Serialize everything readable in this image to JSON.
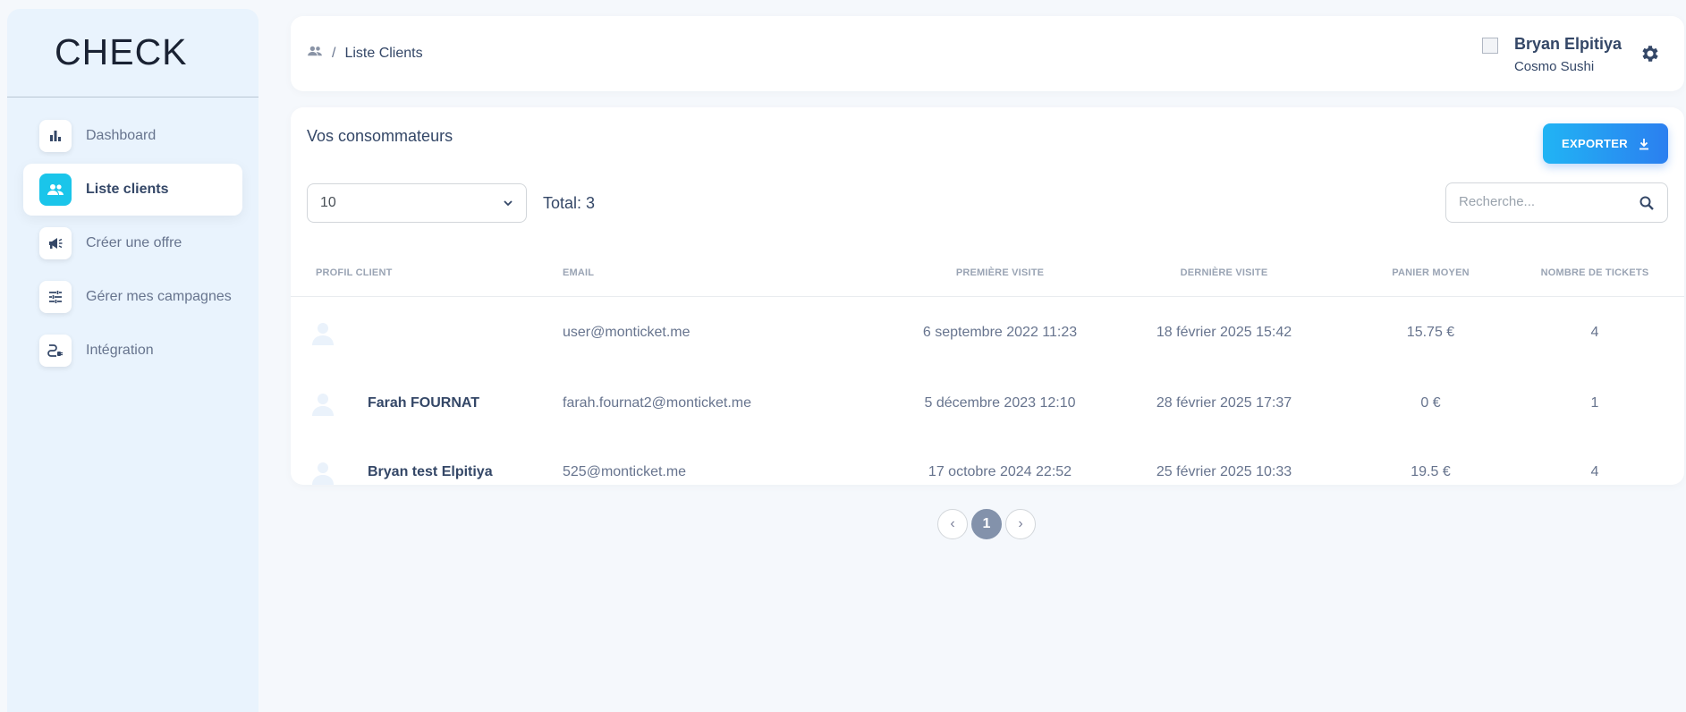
{
  "brand": {
    "logo_text": "CHECK"
  },
  "sidebar": {
    "items": [
      {
        "label": "Dashboard",
        "icon": "bar-chart-icon",
        "active": false
      },
      {
        "label": "Liste clients",
        "icon": "people-icon",
        "active": true
      },
      {
        "label": "Créer une offre",
        "icon": "megaphone-icon",
        "active": false
      },
      {
        "label": "Gérer mes campagnes",
        "icon": "tune-icon",
        "active": false
      },
      {
        "label": "Intégration",
        "icon": "integration-icon",
        "active": false
      }
    ]
  },
  "header": {
    "breadcrumb": {
      "icon": "people-icon",
      "separator": "/",
      "current": "Liste Clients"
    },
    "user": {
      "name": "Bryan Elpitiya",
      "company": "Cosmo Sushi"
    },
    "settings_icon": "gear-icon"
  },
  "main": {
    "title": "Vos consommateurs",
    "export_label": "EXPORTER",
    "page_size": "10",
    "total": "Total: 3",
    "search_placeholder": "Recherche...",
    "columns": [
      "Profil client",
      "Email",
      "Première visite",
      "Dernière visite",
      "Panier moyen",
      "Nombre de tickets"
    ],
    "rows": [
      {
        "name": "",
        "email": "user@monticket.me",
        "first_visit": "6 septembre 2022 11:23",
        "last_visit": "18 février 2025 15:42",
        "avg_basket": "15.75 €",
        "tickets": "4"
      },
      {
        "name": "Farah FOURNAT",
        "email": "farah.fournat2@monticket.me",
        "first_visit": "5 décembre 2023 12:10",
        "last_visit": "28 février 2025 17:37",
        "avg_basket": "0 €",
        "tickets": "1"
      },
      {
        "name": "Bryan test Elpitiya",
        "email": "525@monticket.me",
        "first_visit": "17 octobre 2024 22:52",
        "last_visit": "25 février 2025 10:33",
        "avg_basket": "19.5 €",
        "tickets": "4"
      }
    ]
  },
  "pagination": {
    "prev": "‹",
    "current": "1",
    "next": "›"
  },
  "colors": {
    "accent": "#1ac5ea",
    "button_gradient_start": "#21b4f4",
    "button_gradient_end": "#2b7ff0",
    "text_dark": "#344767",
    "text_muted": "#67748e"
  }
}
